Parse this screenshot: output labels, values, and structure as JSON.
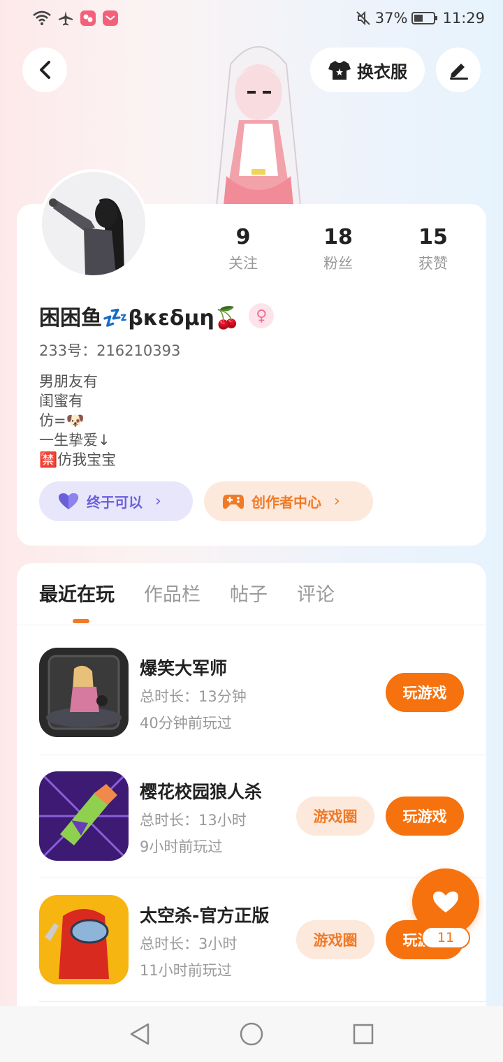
{
  "status_bar": {
    "battery": "37%",
    "time": "11:29",
    "icons": [
      "wifi-icon",
      "airplane-icon",
      "app-notification-icon",
      "app-notification-icon",
      "mute-icon",
      "battery-icon"
    ]
  },
  "header": {
    "back_icon": "chevron-left-icon",
    "outfit_label": "换衣服",
    "outfit_icon": "shirt-icon",
    "edit_icon": "pen-icon"
  },
  "profile": {
    "stats": [
      {
        "value": "9",
        "label": "关注"
      },
      {
        "value": "18",
        "label": "粉丝"
      },
      {
        "value": "15",
        "label": "获赞"
      }
    ],
    "nickname": "困困鱼💤βκεδμη🍒",
    "gender_symbol": "♀",
    "uid": "233号：216210393",
    "bio_lines": [
      "男朋友有",
      "闺蜜有",
      "仿=🐶",
      "一生挚爱↓",
      "🈲仿我宝宝"
    ],
    "tags": [
      {
        "label": "终于可以",
        "icon": "heart-icon"
      },
      {
        "label": "创作者中心",
        "icon": "gamepad-icon"
      }
    ]
  },
  "tabs": [
    "最近在玩",
    "作品栏",
    "帖子",
    "评论"
  ],
  "games": [
    {
      "title": "爆笑大军师",
      "duration": "总时长：13分钟",
      "last_played": "40分钟前玩过",
      "play_label": "玩游戏",
      "circle_label": ""
    },
    {
      "title": "樱花校园狼人杀",
      "duration": "总时长：13小时",
      "last_played": "9小时前玩过",
      "play_label": "玩游戏",
      "circle_label": "游戏圈"
    },
    {
      "title": "太空杀-官方正版",
      "duration": "总时长：3小时",
      "last_played": "11小时前玩过",
      "play_label": "玩游戏",
      "circle_label": "游戏圈"
    }
  ],
  "fab": {
    "count": "11",
    "icon": "heart-icon"
  },
  "nav": {
    "back": "nav-back-icon",
    "home": "nav-home-icon",
    "recents": "nav-recents-icon"
  },
  "colors": {
    "accent": "#f5720f",
    "purple": "#6b5fd9",
    "text": "#222222",
    "muted": "#999999"
  }
}
